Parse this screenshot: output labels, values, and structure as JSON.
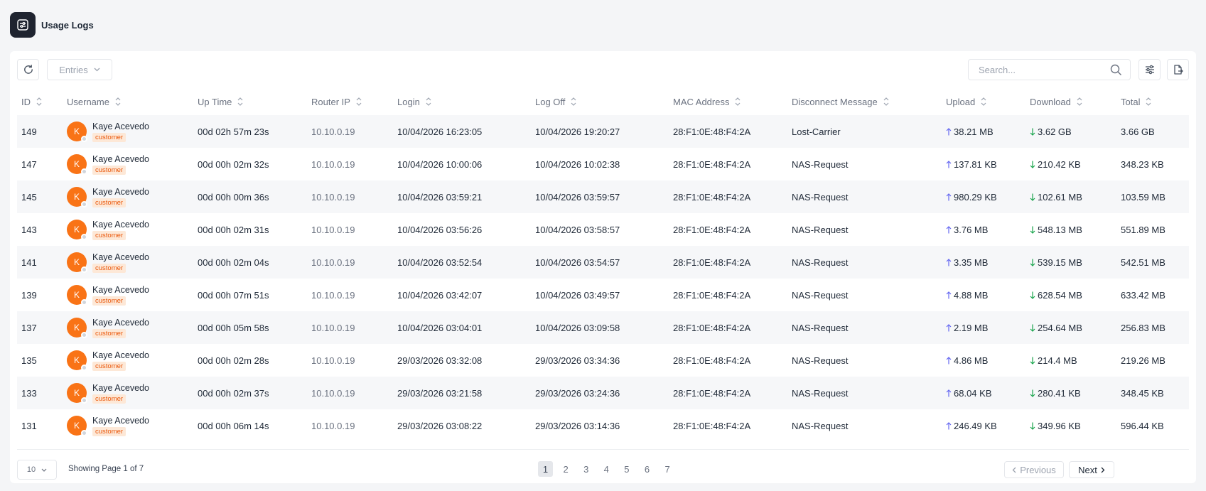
{
  "header": {
    "title": "Usage Logs",
    "icon": "sliders-icon"
  },
  "toolbar": {
    "refresh_icon": "refresh-icon",
    "entries_label": "Entries",
    "search_placeholder": "Search...",
    "filter_icon": "filter-sliders-icon",
    "export_icon": "export-file-icon"
  },
  "table": {
    "columns": [
      "ID",
      "Username",
      "Up Time",
      "Router IP",
      "Login",
      "Log Off",
      "MAC Address",
      "Disconnect Message",
      "Upload",
      "Download",
      "Total"
    ],
    "rows": [
      {
        "id": "149",
        "avatar": "K",
        "name": "Kaye Acevedo",
        "badge": "customer",
        "uptime": "00d 02h 57m 23s",
        "router_ip": "10.10.0.19",
        "login": "10/04/2026 16:23:05",
        "logoff": "10/04/2026 19:20:27",
        "mac": "28:F1:0E:48:F4:2A",
        "message": "Lost-Carrier",
        "upload": "38.21 MB",
        "download": "3.62 GB",
        "total": "3.66 GB"
      },
      {
        "id": "147",
        "avatar": "K",
        "name": "Kaye Acevedo",
        "badge": "customer",
        "uptime": "00d 00h 02m 32s",
        "router_ip": "10.10.0.19",
        "login": "10/04/2026 10:00:06",
        "logoff": "10/04/2026 10:02:38",
        "mac": "28:F1:0E:48:F4:2A",
        "message": "NAS-Request",
        "upload": "137.81 KB",
        "download": "210.42 KB",
        "total": "348.23 KB"
      },
      {
        "id": "145",
        "avatar": "K",
        "name": "Kaye Acevedo",
        "badge": "customer",
        "uptime": "00d 00h 00m 36s",
        "router_ip": "10.10.0.19",
        "login": "10/04/2026 03:59:21",
        "logoff": "10/04/2026 03:59:57",
        "mac": "28:F1:0E:48:F4:2A",
        "message": "NAS-Request",
        "upload": "980.29 KB",
        "download": "102.61 MB",
        "total": "103.59 MB"
      },
      {
        "id": "143",
        "avatar": "K",
        "name": "Kaye Acevedo",
        "badge": "customer",
        "uptime": "00d 00h 02m 31s",
        "router_ip": "10.10.0.19",
        "login": "10/04/2026 03:56:26",
        "logoff": "10/04/2026 03:58:57",
        "mac": "28:F1:0E:48:F4:2A",
        "message": "NAS-Request",
        "upload": "3.76 MB",
        "download": "548.13 MB",
        "total": "551.89 MB"
      },
      {
        "id": "141",
        "avatar": "K",
        "name": "Kaye Acevedo",
        "badge": "customer",
        "uptime": "00d 00h 02m 04s",
        "router_ip": "10.10.0.19",
        "login": "10/04/2026 03:52:54",
        "logoff": "10/04/2026 03:54:57",
        "mac": "28:F1:0E:48:F4:2A",
        "message": "NAS-Request",
        "upload": "3.35 MB",
        "download": "539.15 MB",
        "total": "542.51 MB"
      },
      {
        "id": "139",
        "avatar": "K",
        "name": "Kaye Acevedo",
        "badge": "customer",
        "uptime": "00d 00h 07m 51s",
        "router_ip": "10.10.0.19",
        "login": "10/04/2026 03:42:07",
        "logoff": "10/04/2026 03:49:57",
        "mac": "28:F1:0E:48:F4:2A",
        "message": "NAS-Request",
        "upload": "4.88 MB",
        "download": "628.54 MB",
        "total": "633.42 MB"
      },
      {
        "id": "137",
        "avatar": "K",
        "name": "Kaye Acevedo",
        "badge": "customer",
        "uptime": "00d 00h 05m 58s",
        "router_ip": "10.10.0.19",
        "login": "10/04/2026 03:04:01",
        "logoff": "10/04/2026 03:09:58",
        "mac": "28:F1:0E:48:F4:2A",
        "message": "NAS-Request",
        "upload": "2.19 MB",
        "download": "254.64 MB",
        "total": "256.83 MB"
      },
      {
        "id": "135",
        "avatar": "K",
        "name": "Kaye Acevedo",
        "badge": "customer",
        "uptime": "00d 00h 02m 28s",
        "router_ip": "10.10.0.19",
        "login": "29/03/2026 03:32:08",
        "logoff": "29/03/2026 03:34:36",
        "mac": "28:F1:0E:48:F4:2A",
        "message": "NAS-Request",
        "upload": "4.86 MB",
        "download": "214.4 MB",
        "total": "219.26 MB"
      },
      {
        "id": "133",
        "avatar": "K",
        "name": "Kaye Acevedo",
        "badge": "customer",
        "uptime": "00d 00h 02m 37s",
        "router_ip": "10.10.0.19",
        "login": "29/03/2026 03:21:58",
        "logoff": "29/03/2026 03:24:36",
        "mac": "28:F1:0E:48:F4:2A",
        "message": "NAS-Request",
        "upload": "68.04 KB",
        "download": "280.41 KB",
        "total": "348.45 KB"
      },
      {
        "id": "131",
        "avatar": "K",
        "name": "Kaye Acevedo",
        "badge": "customer",
        "uptime": "00d 00h 06m 14s",
        "router_ip": "10.10.0.19",
        "login": "29/03/2026 03:08:22",
        "logoff": "29/03/2026 03:14:36",
        "mac": "28:F1:0E:48:F4:2A",
        "message": "NAS-Request",
        "upload": "246.49 KB",
        "download": "349.96 KB",
        "total": "596.44 KB"
      }
    ]
  },
  "footer": {
    "page_size": "10",
    "showing": "Showing Page 1 of 7",
    "pages": [
      "1",
      "2",
      "3",
      "4",
      "5",
      "6",
      "7"
    ],
    "current_page": "1",
    "previous_label": "Previous",
    "next_label": "Next"
  },
  "colors": {
    "avatar": "#f97316",
    "badge_text": "#ea580c",
    "badge_bg": "#fde8d7",
    "upload_arrow": "#6366f1",
    "download_arrow": "#16a34a",
    "header_icon_bg": "#1f2430"
  }
}
